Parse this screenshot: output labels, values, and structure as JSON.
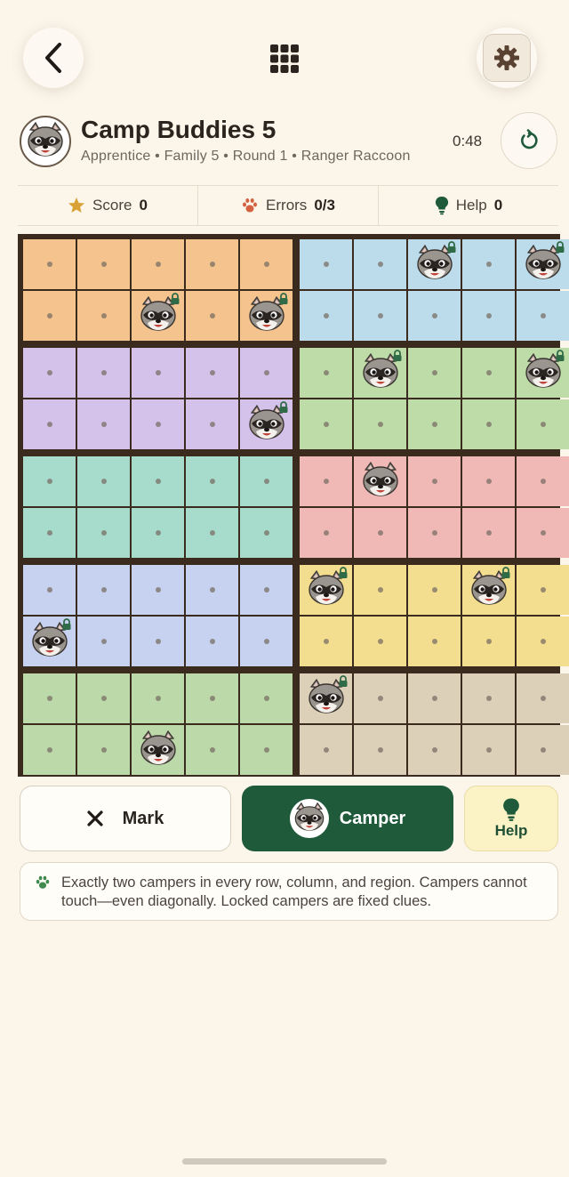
{
  "header": {
    "title": "Camp Buddies 5",
    "subtitle": "Apprentice • Family 5 • Round 1 • Ranger Raccoon",
    "timer": "0:48"
  },
  "stats": {
    "score_label": "Score",
    "score_value": "0",
    "errors_label": "Errors",
    "errors_value": "0/3",
    "help_label": "Help",
    "help_value": "0"
  },
  "board": {
    "rows": 10,
    "cols": 10,
    "regions": [
      [
        "A",
        "A",
        "A",
        "A",
        "A",
        "B",
        "B",
        "B",
        "B",
        "B"
      ],
      [
        "A",
        "A",
        "A",
        "A",
        "A",
        "B",
        "B",
        "B",
        "B",
        "B"
      ],
      [
        "C",
        "C",
        "C",
        "C",
        "C",
        "D",
        "D",
        "D",
        "D",
        "D"
      ],
      [
        "C",
        "C",
        "C",
        "C",
        "C",
        "D",
        "D",
        "D",
        "D",
        "D"
      ],
      [
        "E",
        "E",
        "E",
        "E",
        "E",
        "F",
        "F",
        "F",
        "F",
        "F"
      ],
      [
        "E",
        "E",
        "E",
        "E",
        "E",
        "F",
        "F",
        "F",
        "F",
        "F"
      ],
      [
        "G",
        "G",
        "G",
        "G",
        "G",
        "H",
        "H",
        "H",
        "H",
        "H"
      ],
      [
        "G",
        "G",
        "G",
        "G",
        "G",
        "H",
        "H",
        "H",
        "H",
        "H"
      ],
      [
        "I",
        "I",
        "I",
        "I",
        "I",
        "J",
        "J",
        "J",
        "J",
        "J"
      ],
      [
        "I",
        "I",
        "I",
        "I",
        "I",
        "J",
        "J",
        "J",
        "J",
        "J"
      ]
    ],
    "region_colors": {
      "A": "#f5c48e",
      "B": "#bcdcec",
      "C": "#d5c2ea",
      "D": "#bedca8",
      "E": "#a7dccd",
      "F": "#f1b9b6",
      "G": "#c6d2f0",
      "H": "#f3de8f",
      "I": "#bcd9a9",
      "J": "#ddd0b8"
    },
    "campers": [
      {
        "row": 0,
        "col": 7,
        "locked": true
      },
      {
        "row": 0,
        "col": 9,
        "locked": true
      },
      {
        "row": 1,
        "col": 2,
        "locked": true
      },
      {
        "row": 1,
        "col": 4,
        "locked": true
      },
      {
        "row": 2,
        "col": 6,
        "locked": true
      },
      {
        "row": 2,
        "col": 9,
        "locked": true
      },
      {
        "row": 3,
        "col": 4,
        "locked": true
      },
      {
        "row": 4,
        "col": 6,
        "locked": false
      },
      {
        "row": 6,
        "col": 5,
        "locked": true
      },
      {
        "row": 6,
        "col": 8,
        "locked": true
      },
      {
        "row": 7,
        "col": 0,
        "locked": true
      },
      {
        "row": 8,
        "col": 5,
        "locked": true
      },
      {
        "row": 9,
        "col": 2,
        "locked": false
      }
    ]
  },
  "controls": {
    "mark_label": "Mark",
    "camper_label": "Camper",
    "help_label": "Help"
  },
  "rules": {
    "text": "Exactly two campers in every row, column, and region. Campers cannot touch—even diagonally. Locked campers are fixed clues."
  },
  "icons": {
    "back": "chevron-left-icon",
    "menu": "grid-menu-icon",
    "settings": "gear-icon",
    "restart": "restart-icon",
    "score": "star-icon",
    "errors": "paw-icon",
    "help": "lightbulb-icon",
    "mark": "x-icon",
    "camper": "raccoon-icon",
    "lock": "lock-icon"
  }
}
